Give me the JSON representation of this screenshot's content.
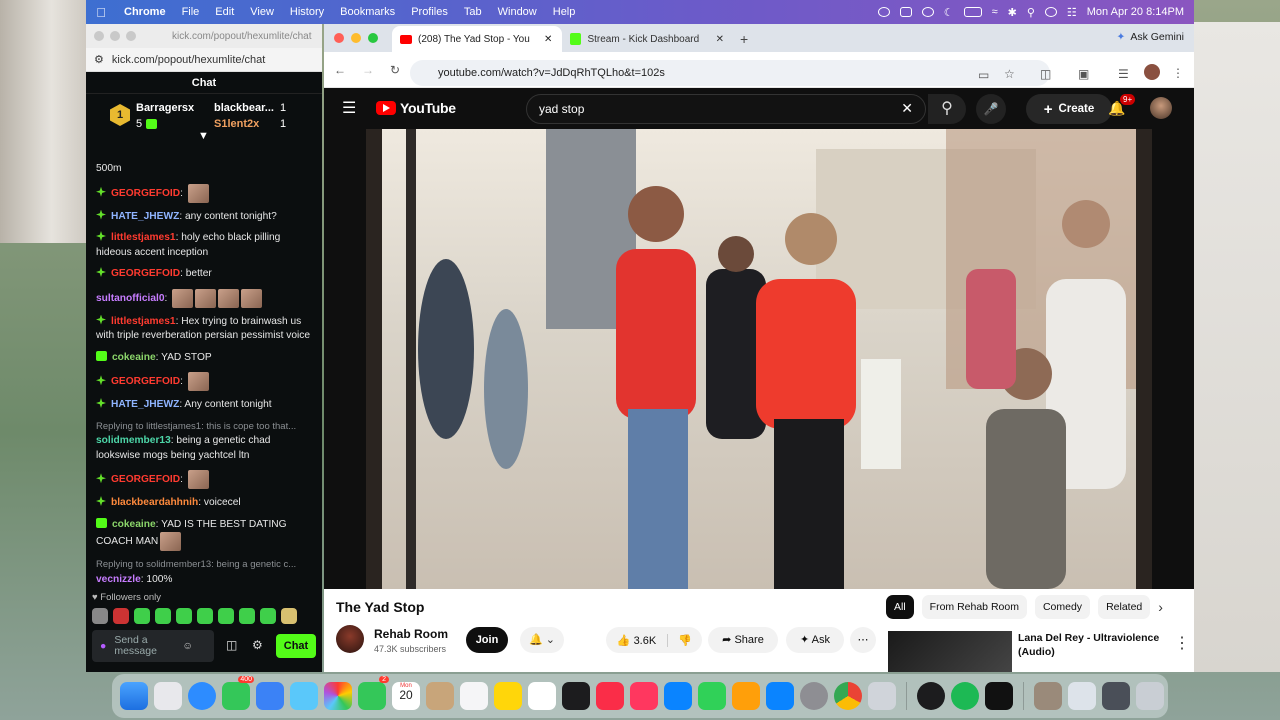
{
  "menubar": {
    "app": "Chrome",
    "items": [
      "File",
      "Edit",
      "View",
      "History",
      "Bookmarks",
      "Profiles",
      "Tab",
      "Window",
      "Help"
    ],
    "clock": "Mon Apr 20  8:14PM"
  },
  "chat_window": {
    "title_url": "kick.com/popout/hexumlite/chat",
    "address": "kick.com/popout/hexumlite/chat",
    "header": "Chat",
    "top": {
      "rank": "1",
      "first_name": "Barragersx",
      "first_count": "5",
      "second_name": "blackbear...",
      "second_count": "1",
      "third_name": "S1lent2x",
      "third_count": "1"
    },
    "partial_line": "500m",
    "messages": [
      {
        "badge": "diamond",
        "user": "GEORGEFOID",
        "cls": "u-red",
        "text": "",
        "emotes": 1
      },
      {
        "badge": "diamond",
        "user": "HATE_JHEWZ",
        "cls": "u-blue",
        "text": "any content tonight?",
        "emotes": 0
      },
      {
        "badge": "diamond",
        "user": "littlestjames1",
        "cls": "u-red",
        "text": "holy echo black pilling hideous accent inception",
        "emotes": 0
      },
      {
        "badge": "diamond",
        "user": "GEORGEFOID",
        "cls": "u-red",
        "text": "better",
        "emotes": 0
      },
      {
        "badge": "none",
        "user": "sultanofficial0",
        "cls": "u-purple",
        "text": "",
        "emotes": 4
      },
      {
        "badge": "diamond",
        "user": "littlestjames1",
        "cls": "u-red",
        "text": "Hex trying to brainwash us with triple reverberation persian pessimist voice",
        "emotes": 0
      },
      {
        "badge": "box",
        "user": "cokeaine",
        "cls": "u-green",
        "text": "YAD STOP",
        "emotes": 0
      },
      {
        "badge": "diamond",
        "user": "GEORGEFOID",
        "cls": "u-red",
        "text": "",
        "emotes": 1
      },
      {
        "badge": "diamond",
        "user": "HATE_JHEWZ",
        "cls": "u-blue",
        "text": "Any content tonight",
        "emotes": 0
      },
      {
        "reply": "Replying to littlestjames1: this is cope too that...",
        "badge": "none",
        "user": "solidmember13",
        "cls": "u-teal",
        "text": "being a genetic chad lookswise mogs being yachtcel ltn",
        "emotes": 0
      },
      {
        "badge": "diamond",
        "user": "GEORGEFOID",
        "cls": "u-red",
        "text": "",
        "emotes": 1
      },
      {
        "badge": "diamond",
        "user": "blackbeardahhnih",
        "cls": "u-orange",
        "text": "voicecel",
        "emotes": 0
      },
      {
        "badge": "box",
        "user": "cokeaine",
        "cls": "u-green",
        "text": "YAD IS THE BEST DATING COACH MAN",
        "emotes": 1
      },
      {
        "reply": "Replying to solidmember13: being a genetic c...",
        "badge": "none",
        "user": "vecnizzle",
        "cls": "u-purple",
        "text": "100%",
        "emotes": 0
      }
    ],
    "followers_only": "Followers only",
    "send_placeholder": "Send a message",
    "chat_button": "Chat"
  },
  "browser": {
    "tab1": "(208) The Yad Stop - You",
    "tab2": "Stream - Kick Dashboard",
    "ask_gemini": "Ask Gemini",
    "url": "youtube.com/watch?v=JdDqRhTQLho&t=102s"
  },
  "youtube": {
    "logo": "YouTube",
    "search_value": "yad stop",
    "create": "Create",
    "notif_badge": "9+",
    "video_title": "The Yad Stop",
    "channel": "Rehab Room",
    "subscribers": "47.3K subscribers",
    "join": "Join",
    "likes": "3.6K",
    "share": "Share",
    "ask": "Ask",
    "chips": [
      "All",
      "From Rehab Room",
      "Comedy",
      "Related"
    ],
    "rec_title": "Lana Del Rey - Ultraviolence (Audio)"
  },
  "dock": {
    "messages_badge": "400",
    "facetime_badge": "2",
    "calendar_month": "Mon",
    "calendar_day": "20"
  }
}
